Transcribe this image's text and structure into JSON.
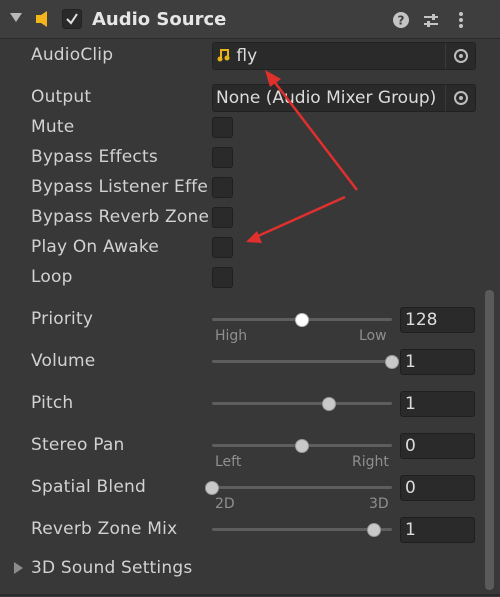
{
  "header": {
    "title": "Audio Source",
    "enabled": true,
    "icons": [
      "audio-source-icon",
      "help-icon",
      "presets-icon",
      "more-icon"
    ]
  },
  "fields": {
    "audio_clip": {
      "label": "AudioClip",
      "value": "fly",
      "icon": "audio-clip-icon"
    },
    "output": {
      "label": "Output",
      "value": "None (Audio Mixer Group)"
    }
  },
  "toggles": [
    {
      "label": "Mute",
      "checked": false
    },
    {
      "label": "Bypass Effects",
      "checked": false
    },
    {
      "label": "Bypass Listener Effe",
      "checked": false
    },
    {
      "label": "Bypass Reverb Zone",
      "checked": false
    },
    {
      "label": "Play On Awake",
      "checked": false
    },
    {
      "label": "Loop",
      "checked": false
    }
  ],
  "sliders": [
    {
      "label": "Priority",
      "value": "128",
      "fraction": 0.5,
      "min_label": "High",
      "max_label": "Low"
    },
    {
      "label": "Volume",
      "value": "1",
      "fraction": 1.0
    },
    {
      "label": "Pitch",
      "value": "1",
      "fraction": 0.65
    },
    {
      "label": "Stereo Pan",
      "value": "0",
      "fraction": 0.5,
      "min_label": "Left",
      "max_label": "Right"
    },
    {
      "label": "Spatial Blend",
      "value": "0",
      "fraction": 0.0,
      "min_label": "2D",
      "max_label": "3D"
    },
    {
      "label": "Reverb Zone Mix",
      "value": "1",
      "fraction": 0.9
    }
  ],
  "foldout": {
    "label": "3D Sound Settings",
    "expanded": false
  },
  "colors": {
    "background": "#383838",
    "annotation_arrow": "#e0302e",
    "clip_icon": "#e8b21a",
    "speaker_icon": "#f2b51c"
  }
}
